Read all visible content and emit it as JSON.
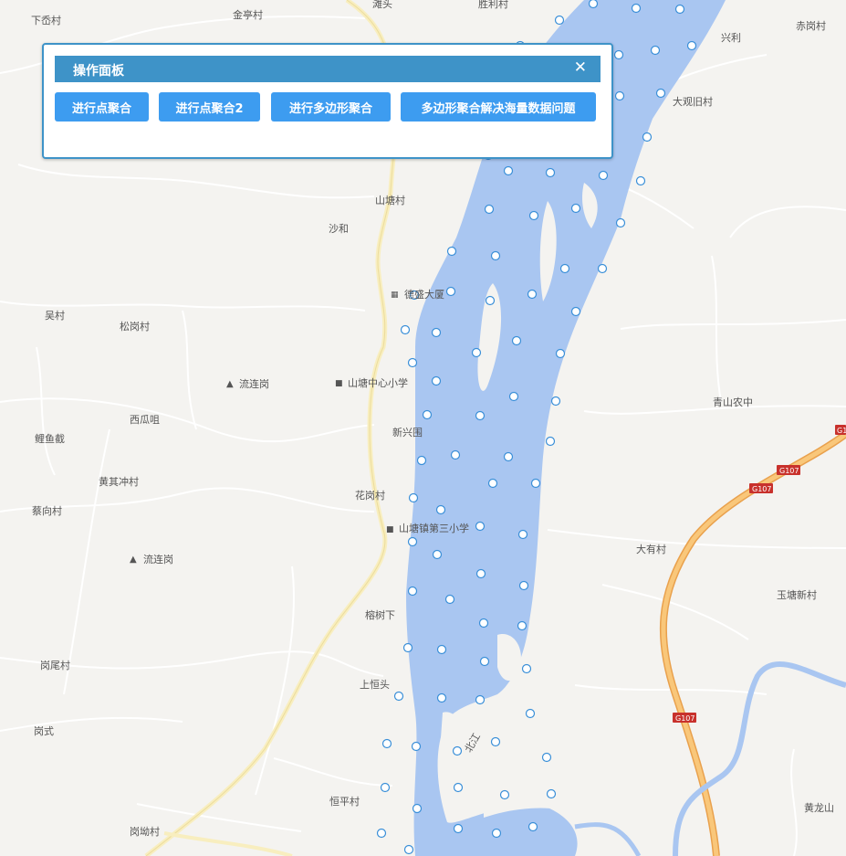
{
  "panel": {
    "title": "操作面板",
    "close_symbol": "✕",
    "buttons": [
      "进行点聚合",
      "进行点聚合2",
      "进行多边形聚合",
      "多边形聚合解决海量数据问题"
    ]
  },
  "map": {
    "place_labels": [
      "下岙村",
      "金亭村",
      "滩头",
      "胜利村",
      "赤岗村",
      "兴利",
      "大观旧村",
      "山塘村",
      "沙和",
      "德盛大厦",
      "吴村",
      "松岗村",
      "流连岗",
      "山塘中心小学",
      "青山农中",
      "西瓜咀",
      "新兴围",
      "鲤鱼截",
      "黄其冲村",
      "花岗村",
      "蔡向村",
      "山塘镇第三小学",
      "大有村",
      "流连岗",
      "玉塘新村",
      "榕树下",
      "岗尾村",
      "上恒头",
      "岗式",
      "恒平村",
      "黄龙山",
      "岗坳村"
    ],
    "river_label": "北江",
    "road_labels": [
      "G107",
      "G107",
      "G107",
      "G1"
    ],
    "colors": {
      "river": "#a9c6f1",
      "point": "#3a8fd8",
      "highway": "#f4b65d",
      "panel": "#3e93c8"
    }
  }
}
